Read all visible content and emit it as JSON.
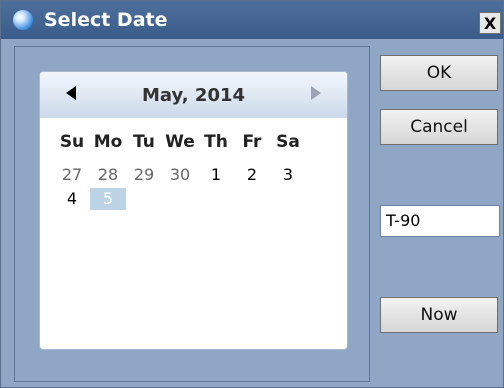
{
  "window": {
    "title": "Select Date",
    "close_label": "X",
    "icon": "app-globe-icon"
  },
  "calendar": {
    "month_label": "May, 2014",
    "prev_icon": "triangle-left-icon",
    "next_icon": "triangle-right-icon",
    "weekdays": [
      "Su",
      "Mo",
      "Tu",
      "We",
      "Th",
      "Fr",
      "Sa"
    ],
    "rows": [
      [
        {
          "label": "27",
          "muted": true
        },
        {
          "label": "28",
          "muted": true
        },
        {
          "label": "29",
          "muted": true
        },
        {
          "label": "30",
          "muted": true
        },
        {
          "label": "1",
          "muted": false
        },
        {
          "label": "2",
          "muted": false
        },
        {
          "label": "3",
          "muted": false
        }
      ],
      [
        {
          "label": "4",
          "muted": false
        },
        {
          "label": "5",
          "muted": false,
          "selected": true
        }
      ]
    ]
  },
  "buttons": {
    "ok": "OK",
    "cancel": "Cancel",
    "now": "Now"
  },
  "offset_field": {
    "value": "T-90"
  },
  "colors": {
    "titlebar": "#3a5c8a",
    "panel": "#8fa7c4",
    "selected_day": "#bcd3e6"
  }
}
